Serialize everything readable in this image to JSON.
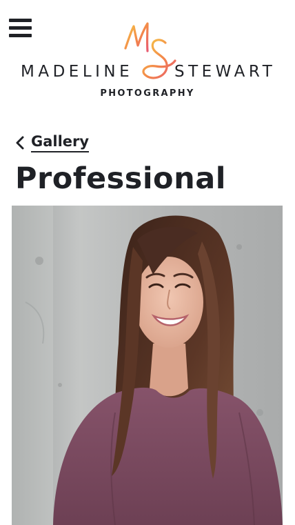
{
  "header": {
    "menu_icon": "hamburger-menu-icon",
    "logo": {
      "monogram": "MS",
      "name_left": "MADELINE",
      "name_right": "STEWART",
      "subtitle": "PHOTOGRAPHY",
      "colors": [
        "#f6c945",
        "#f3874a",
        "#e85a71"
      ]
    }
  },
  "back_link": {
    "icon": "chevron-left-icon",
    "label": "Gallery"
  },
  "page": {
    "title": "Professional"
  },
  "photo": {
    "subject": "professional portrait",
    "palette": {
      "background": "#b7b9b9",
      "hair": "#4a2c22",
      "top": "#7a4a5e",
      "skin": "#e7b8a2"
    }
  },
  "colors": {
    "text": "#1f2126",
    "background": "#ffffff"
  }
}
